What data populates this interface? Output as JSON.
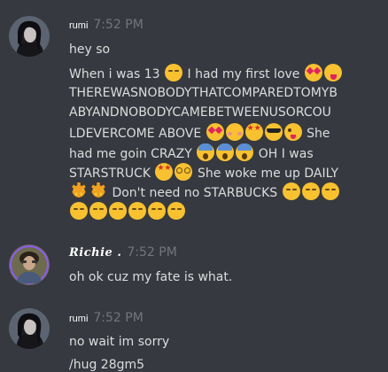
{
  "colors": {
    "background": "#36393f",
    "text": "#dcddde",
    "timestamp": "#72767d",
    "username": "#ffffff"
  },
  "messages": [
    {
      "username": "rumi",
      "timestamp": "7:52 PM",
      "avatar": "dark-haired-avatar",
      "lines": [
        "hey so",
        "When i was 13",
        "I had my first love",
        "THEREWASNOBODYTHATCOMPAREDTOMYB",
        "ABYANDNOBODYCAMEBETWEENUSORCOU",
        "LDEVERCOME ABOVE",
        "She",
        "had me goin CRAZY",
        "OH I was",
        "STARSTRUCK",
        "She woke me up DAILY",
        "Don't need no STARBUCKS"
      ]
    },
    {
      "username": "Richie .",
      "timestamp": "7:52 PM",
      "avatar": "portrait-avatar",
      "lines": [
        "oh ok cuz my fate is what."
      ]
    },
    {
      "username": "rumi",
      "timestamp": "7:52 PM",
      "avatar": "dark-haired-avatar",
      "lines": [
        "no wait im sorry",
        "/hug 28gm5"
      ]
    }
  ],
  "emoji_names": [
    "smirk-emoji",
    "heart-eyes-emoji",
    "tongue-emoji",
    "blush-emoji",
    "star-struck-emoji",
    "sunglasses-emoji",
    "wink-tongue-emoji",
    "scream-emoji",
    "dizzy-emoji",
    "sun-emoji"
  ]
}
